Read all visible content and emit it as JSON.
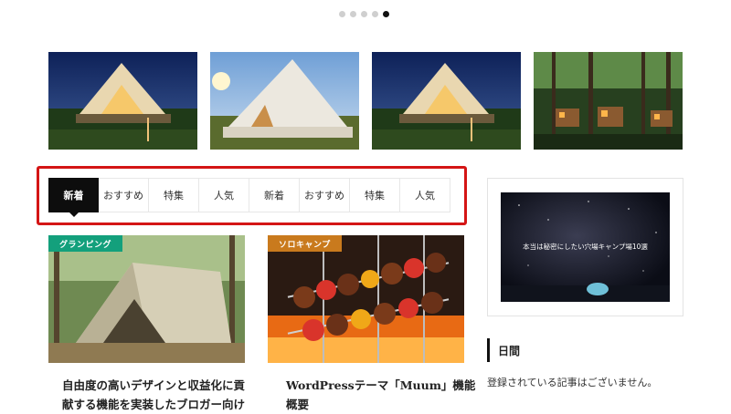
{
  "carousel": {
    "dot_count": 5,
    "active_index": 4
  },
  "tabs": [
    {
      "label": "新着",
      "active": true
    },
    {
      "label": "おすすめ",
      "active": false
    },
    {
      "label": "特集",
      "active": false
    },
    {
      "label": "人気",
      "active": false
    },
    {
      "label": "新着",
      "active": false
    },
    {
      "label": "おすすめ",
      "active": false
    },
    {
      "label": "特集",
      "active": false
    },
    {
      "label": "人気",
      "active": false
    }
  ],
  "cards": [
    {
      "badge": "グランピング",
      "badge_color": "#13a07c",
      "title": "自由度の高いデザインと収益化に貢献する機能を実装したブロガー向け"
    },
    {
      "badge": "ソロキャンプ",
      "badge_color": "#c97a1d",
      "title": "WordPressテーマ「Muum」機能概要"
    }
  ],
  "sidebar": {
    "banner_text": "本当は秘密にしたい穴場キャンプ場10選",
    "section_heading": "日間",
    "empty_message": "登録されている記事はございません。"
  },
  "colors": {
    "highlight_border": "#d41515",
    "active_tab": "#0d0d0d"
  }
}
